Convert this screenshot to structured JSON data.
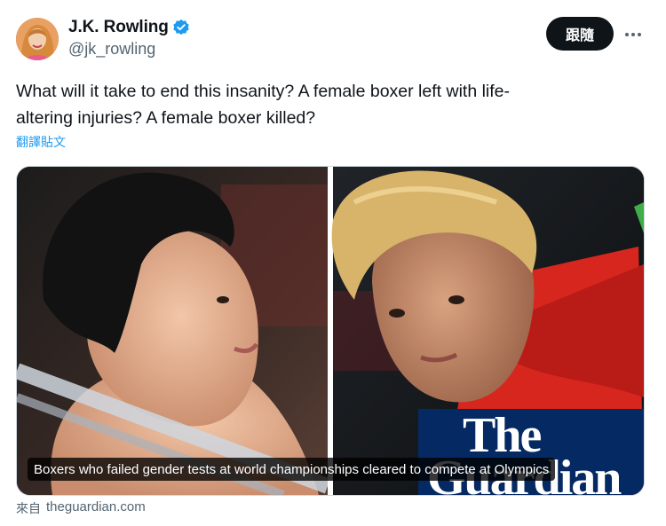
{
  "author": {
    "display_name": "J.K. Rowling",
    "handle": "@jk_rowling",
    "verified": true,
    "verified_color": "#1d9bf0"
  },
  "actions": {
    "follow_label": "跟隨",
    "more_icon": "more-horizontal-icon"
  },
  "tweet": {
    "text_line1": "What will it take to end this insanity? A  female boxer left with life-",
    "text_line2": "altering injuries? A female boxer killed?",
    "translate_label": "翻譯貼文"
  },
  "card": {
    "logo_line1": "The",
    "logo_line2": "Guardian",
    "logo_color": "#052962",
    "caption": "Boxers who failed gender tests at world championships cleared to compete at Olympics"
  },
  "source": {
    "from_label": "來自",
    "domain": "theguardian.com"
  }
}
